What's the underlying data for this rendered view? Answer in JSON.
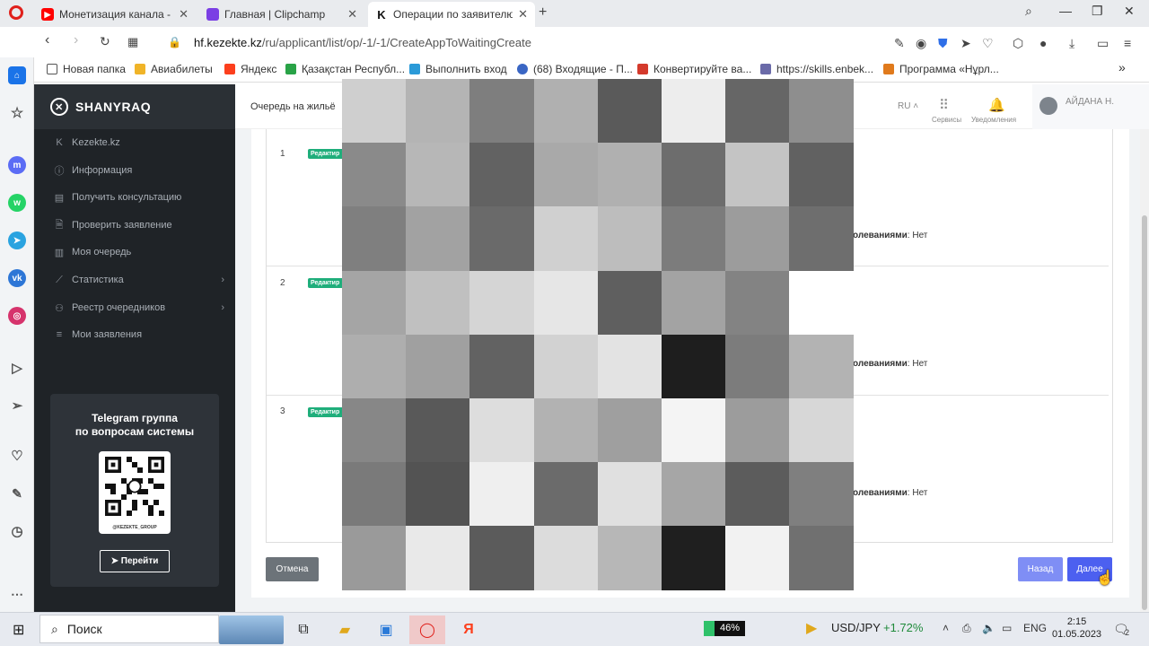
{
  "browser": {
    "tabs": [
      {
        "title": "Монетизация канала - You",
        "icon": "youtube-icon",
        "color": "#ff0000"
      },
      {
        "title": "Главная | Clipchamp",
        "icon": "clipchamp-icon",
        "color": "#7b3fe4"
      },
      {
        "title": "Операции по заявителю",
        "icon": "kezekte-k-icon",
        "color": "#111111"
      }
    ],
    "url_host": "hf.kezekte.kz",
    "url_path": "/ru/applicant/list/op/-1/-1/CreateAppToWaitingCreate",
    "bookmarks": [
      {
        "label": "Новая папка",
        "icon": "folder-icon"
      },
      {
        "label": "Авиабилеты",
        "icon": "plane-icon"
      },
      {
        "label": "Яндекс",
        "icon": "yandex-icon"
      },
      {
        "label": "Қазақстан Республ...",
        "icon": "egov-icon"
      },
      {
        "label": "Выполнить вход",
        "icon": "fish-icon"
      },
      {
        "label": "(68) Входящие - П...",
        "icon": "mail-icon"
      },
      {
        "label": "Конвертируйте ва...",
        "icon": "heart-icon"
      },
      {
        "label": "https://skills.enbek...",
        "icon": "enbek-icon"
      },
      {
        "label": "Программа «Нұрл...",
        "icon": "program-icon"
      }
    ]
  },
  "sidebar": {
    "brand": "SHANYRAQ",
    "items": [
      {
        "label": "Kezekte.kz",
        "icon": "k-icon",
        "has_chevron": false
      },
      {
        "label": "Информация",
        "icon": "info-icon",
        "has_chevron": false
      },
      {
        "label": "Получить консультацию",
        "icon": "consult-icon",
        "has_chevron": false
      },
      {
        "label": "Проверить заявление",
        "icon": "check-doc-icon",
        "has_chevron": false
      },
      {
        "label": "Моя очередь",
        "icon": "queue-icon",
        "has_chevron": false
      },
      {
        "label": "Статистика",
        "icon": "chart-icon",
        "has_chevron": true
      },
      {
        "label": "Реестр очередников",
        "icon": "registry-icon",
        "has_chevron": true
      },
      {
        "label": "Мои заявления",
        "icon": "list-icon",
        "has_chevron": false
      }
    ],
    "telegram": {
      "title_line1": "Telegram группа",
      "title_line2": "по вопросам системы",
      "qr_caption": "@KEZEKTE_GROUP",
      "button": "Перейти"
    }
  },
  "header": {
    "page_title": "Очередь на жильё",
    "lang": "RU",
    "services": "Сервисы",
    "notifications": "Уведомления",
    "user": "АЙДАНА Н."
  },
  "rows": [
    {
      "num": "1",
      "badge": "Редактир",
      "label": "олеваниями",
      "value": ": Нет"
    },
    {
      "num": "2",
      "badge": "Редактир",
      "label": "олеваниями",
      "value": ": Нет"
    },
    {
      "num": "3",
      "badge": "Редактир",
      "label": "олеваниями",
      "value": ": Нет"
    }
  ],
  "actions": {
    "cancel": "Отмена",
    "back": "Назад",
    "next": "Далее"
  },
  "pixel_shades": [
    [
      "#cfcfcf",
      "#b4b4b4",
      "#7e7e7e",
      "#b0b0b0",
      "#5a5a5a",
      "#ededed",
      "#666666",
      "#8e8e8e"
    ],
    [
      "#8a8a8a",
      "#b7b7b7",
      "#626262",
      "#a9a9a9",
      "#b0b0b0",
      "#6d6d6d",
      "#c4c4c4",
      "#616161"
    ],
    [
      "#7f7f7f",
      "#a2a2a2",
      "#6a6a6a",
      "#d0d0d0",
      "#bdbdbd",
      "#7c7c7c",
      "#9c9c9c",
      "#6e6e6e"
    ],
    [
      "#a5a5a5",
      "#c0c0c0",
      "#d5d5d5",
      "#e6e6e6",
      "#5f5f5f",
      "#a3a3a3",
      "#838383",
      "#ffffff"
    ],
    [
      "#aeaeae",
      "#a0a0a0",
      "#626262",
      "#d2d2d2",
      "#e3e3e3",
      "#1e1e1e",
      "#7c7c7c",
      "#b3b3b3"
    ],
    [
      "#878787",
      "#595959",
      "#dddddd",
      "#b2b2b2",
      "#9f9f9f",
      "#f4f4f4",
      "#9c9c9c",
      "#d7d7d7"
    ],
    [
      "#7a7a7a",
      "#535353",
      "#efefef",
      "#6b6b6b",
      "#e0e0e0",
      "#a6a6a6",
      "#5c5c5c",
      "#7f7f7f"
    ],
    [
      "#9a9a9a",
      "#e9e9e9",
      "#5b5b5b",
      "#dcdcdc",
      "#b7b7b7",
      "#1f1f1f",
      "#f2f2f2",
      "#707070"
    ]
  ],
  "taskbar": {
    "search": "Поиск",
    "battery": "46%",
    "forex_pair": "USD/JPY",
    "forex_change": "+1.72%",
    "lang": "ENG",
    "time": "2:15",
    "date": "01.05.2023",
    "notif_count": "2"
  }
}
